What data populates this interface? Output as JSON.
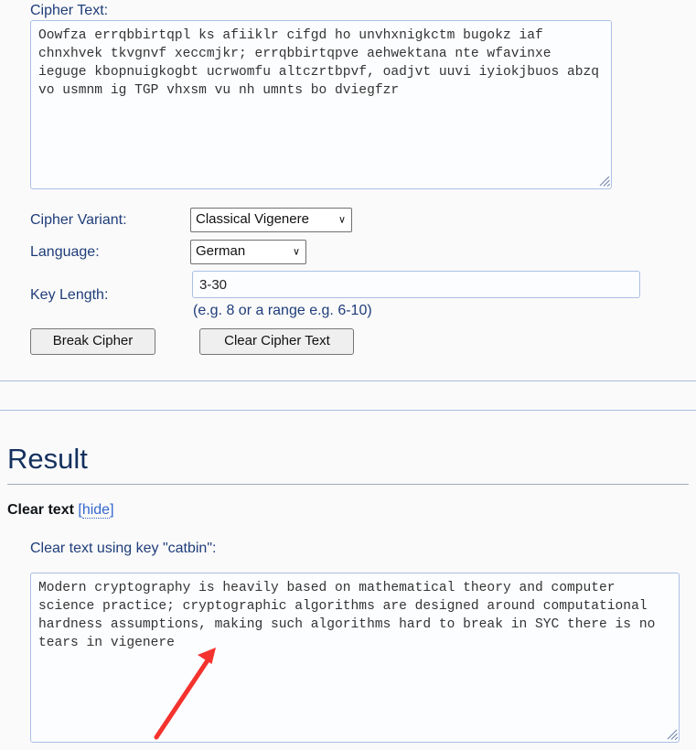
{
  "form": {
    "cipher_text_label": "Cipher Text:",
    "cipher_text_value": "Oowfza errqbbirtqpl ks afiiklr cifgd ho unvhxnigkctm bugokz iaf chnxhvek tkvgnvf xeccmjkr; errqbbirtqpve aehwektana nte wfavinxe ieguge kbopnuigkogbt ucrwomfu altczrtbpvf, oadjvt uuvi iyiokjbuos abzq vo usmnm ig TGP vhxsm vu nh umnts bo dviegfzr",
    "cipher_text_placeholder": "",
    "variant_label": "Cipher Variant:",
    "variant_value": "Classical Vigenere",
    "variant_options": [
      "Classical Vigenere"
    ],
    "language_label": "Language:",
    "language_value": "German",
    "language_options": [
      "German"
    ],
    "key_length_label": "Key Length:",
    "key_length_value": "3-30",
    "key_length_placeholder": "",
    "key_length_hint": "(e.g. 8 or a range e.g. 6-10)",
    "break_button_label": "Break Cipher",
    "clear_button_label": "Clear Cipher Text",
    "chevron_glyph": "∨"
  },
  "result": {
    "heading": "Result",
    "clear_text_label": "Clear text",
    "bracket_open": "[",
    "hide_link_label": "hide",
    "bracket_close": "]",
    "key_line": "Clear text using key \"catbin\":",
    "clear_text_value": "Modern cryptography is heavily based on mathematical theory and computer science practice; cryptographic algorithms are designed around computational hardness assumptions, making such algorithms hard to break in SYC there is no tears in vigenere"
  },
  "annotation": {
    "arrow_color": "#f4322e",
    "arrow_target_text": "SYC"
  },
  "colors": {
    "page_background": "#fafafa",
    "heading_blue": "#14315e",
    "label_blue": "#1f3d7a",
    "link_blue": "#3366cc",
    "input_border": "#aac0e6",
    "rule_blue": "#a8bde0",
    "button_face": "#efefef"
  }
}
